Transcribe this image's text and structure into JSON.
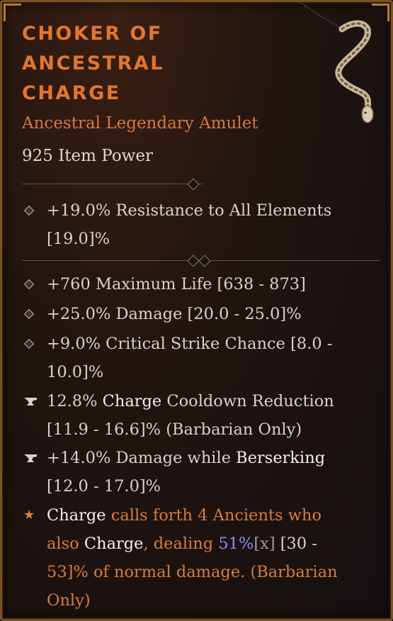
{
  "item": {
    "name": "CHOKER OF ANCESTRAL CHARGE",
    "name_lines": [
      "CHOKER OF",
      "ANCESTRAL",
      "CHARGE"
    ],
    "type": "Ancestral Legendary Amulet",
    "power": "925 Item Power"
  },
  "implicit": {
    "line1": "+19.0% Resistance to All Elements",
    "line2": "[19.0]%"
  },
  "affixes": [
    {
      "line1": "+760 Maximum Life [638 - 873]"
    },
    {
      "line1": "+25.0% Damage [20.0 - 25.0]%"
    },
    {
      "line1": "+9.0% Critical Strike Chance [8.0 -",
      "line2": "10.0]%"
    }
  ],
  "tempered": [
    {
      "value": "12.8% ",
      "keyword": "Charge",
      "rest": " Cooldown Reduction",
      "line2": "[11.9 - 16.6]% (Barbarian Only)"
    },
    {
      "value": "+14.0% Damage while ",
      "keyword": "Berserking",
      "line2": "[12.0 - 17.0]%"
    }
  ],
  "legendary": {
    "p1": "Charge",
    "p2": " calls forth 4 Ancients who",
    "p3": "also ",
    "p4": "Charge",
    "p5": ", dealing ",
    "p6": "51%",
    "p7": "[x]",
    "p8": " [30 -",
    "p9": "53]% of normal damage. (Barbarian",
    "p10": "Only)"
  },
  "colors": {
    "title": "#e2762c",
    "legendary_text": "#dc7c36",
    "multiplier": "#8b8ff0",
    "border": "#7a5324"
  },
  "icons": {
    "affix_bullet": "diamond-bullet-icon",
    "tempered_bullet": "anvil-icon",
    "legendary_bullet": "star-icon",
    "item_image": "snake-amulet-icon"
  }
}
